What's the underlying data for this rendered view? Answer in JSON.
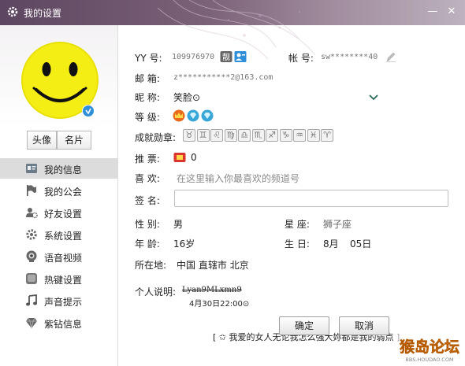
{
  "window": {
    "title": "我的设置",
    "minimize_glyph": "—",
    "close_glyph": "✕"
  },
  "left": {
    "tabs": {
      "avatar": "头像",
      "card": "名片"
    },
    "nav": [
      {
        "label": "我的信息",
        "icon": "id-card-icon",
        "active": true
      },
      {
        "label": "我的公会",
        "icon": "flag-icon",
        "active": false
      },
      {
        "label": "好友设置",
        "icon": "friends-gear-icon",
        "active": false
      },
      {
        "label": "系统设置",
        "icon": "gear-icon",
        "active": false
      },
      {
        "label": "语音视频",
        "icon": "camera-icon",
        "active": false
      },
      {
        "label": "热键设置",
        "icon": "keyboard-key-icon",
        "active": false
      },
      {
        "label": "声音提示",
        "icon": "music-note-icon",
        "active": false
      },
      {
        "label": "紫钻信息",
        "icon": "diamond-icon",
        "active": false
      }
    ]
  },
  "profile": {
    "yy_label": "YY  号:",
    "yy_value": "109976970",
    "account_label": "帐  号:",
    "account_value": "sw********40",
    "email_label": "邮  箱:",
    "email_value": "z***********2@163.com",
    "nickname_label": "昵  称:",
    "nickname_value": "笑脸⊙",
    "level_label": "等  级:",
    "medals_label": "成就勋章:",
    "medal_glyphs": [
      "♉",
      "♊",
      "♌",
      "♍",
      "♎",
      "♏",
      "♐",
      "♑",
      "♒",
      "♓",
      "♈"
    ],
    "vote_label": "推  票:",
    "vote_value": "0",
    "likes_label": "喜  欢:",
    "likes_placeholder": "在这里输入你最喜欢的频道号",
    "signature_label": "签  名:",
    "signature_value": "",
    "gender_label": "性  别:",
    "gender_value": "男",
    "zodiac_label": "星  座:",
    "zodiac_value": "狮子座",
    "age_label": "年  龄:",
    "age_value": "16岁",
    "birthday_label": "生  日:",
    "birthday_month": "8月",
    "birthday_day": "05日",
    "location_label": "所在地:",
    "location_value": "中国  直辖市  北京",
    "bio_label": "个人说明:",
    "bio_line1": "Lyan9MLxmn9",
    "bio_line2": "4月30日22:00⊙",
    "marquee": "[  ✩  我爱的女人无论我怎么强大妳都是我的弱点  ]"
  },
  "buttons": {
    "ok": "确定",
    "cancel": "取消"
  },
  "watermark": {
    "text": "猴岛论坛",
    "url": "BBS.HOUDAO.COM"
  },
  "colors": {
    "titlebar": "#6b5470",
    "accent_blue": "#2f8fd8",
    "vote_red": "#d9352a",
    "active_nav": "#dcdcdc"
  }
}
